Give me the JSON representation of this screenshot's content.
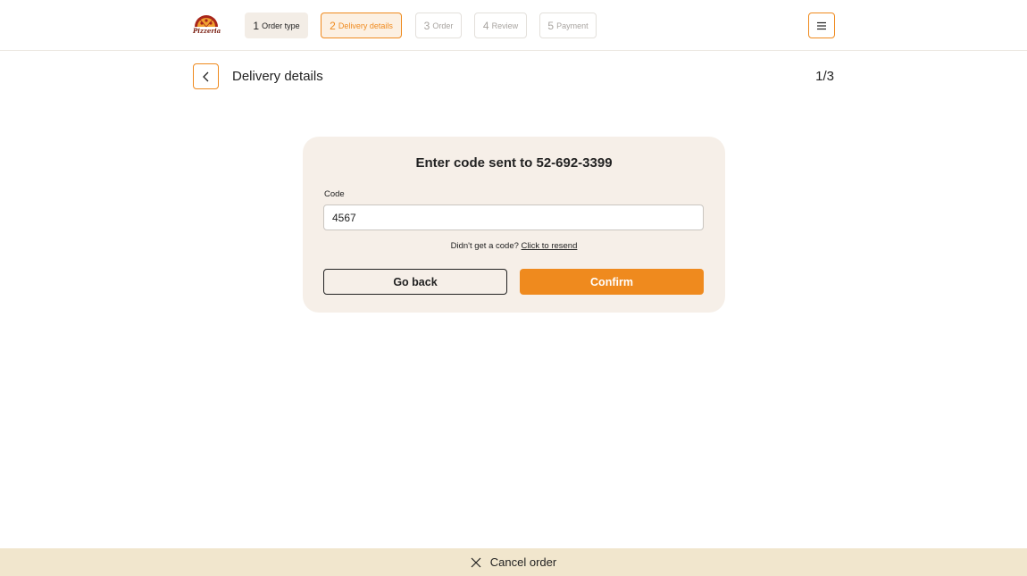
{
  "header": {
    "logo_text": "Pizzeria",
    "steps": [
      {
        "num": "1",
        "label": "Order type",
        "state": "done"
      },
      {
        "num": "2",
        "label": "Delivery details",
        "state": "active"
      },
      {
        "num": "3",
        "label": "Order",
        "state": "pending"
      },
      {
        "num": "4",
        "label": "Review",
        "state": "pending"
      },
      {
        "num": "5",
        "label": "Payment",
        "state": "pending"
      }
    ],
    "menu_icon": "hamburger-icon"
  },
  "page": {
    "back_icon": "chevron-left-icon",
    "title": "Delivery details",
    "counter": "1/3"
  },
  "verify": {
    "title": "Enter code sent to 52-692-3399",
    "code_label": "Code",
    "code_value": "4567",
    "resend_text": "Didn't get a code?",
    "resend_link": "Click to resend",
    "go_back_label": "Go back",
    "confirm_label": "Confirm"
  },
  "footer": {
    "close_icon": "close-icon",
    "cancel_label": "Cancel order"
  },
  "colors": {
    "accent": "#ef8a1e",
    "card_bg": "#f6efe8",
    "cancel_bar_bg": "#f1e6cd",
    "step_done_bg": "#f3ede6",
    "logo_red": "#a8261a"
  }
}
